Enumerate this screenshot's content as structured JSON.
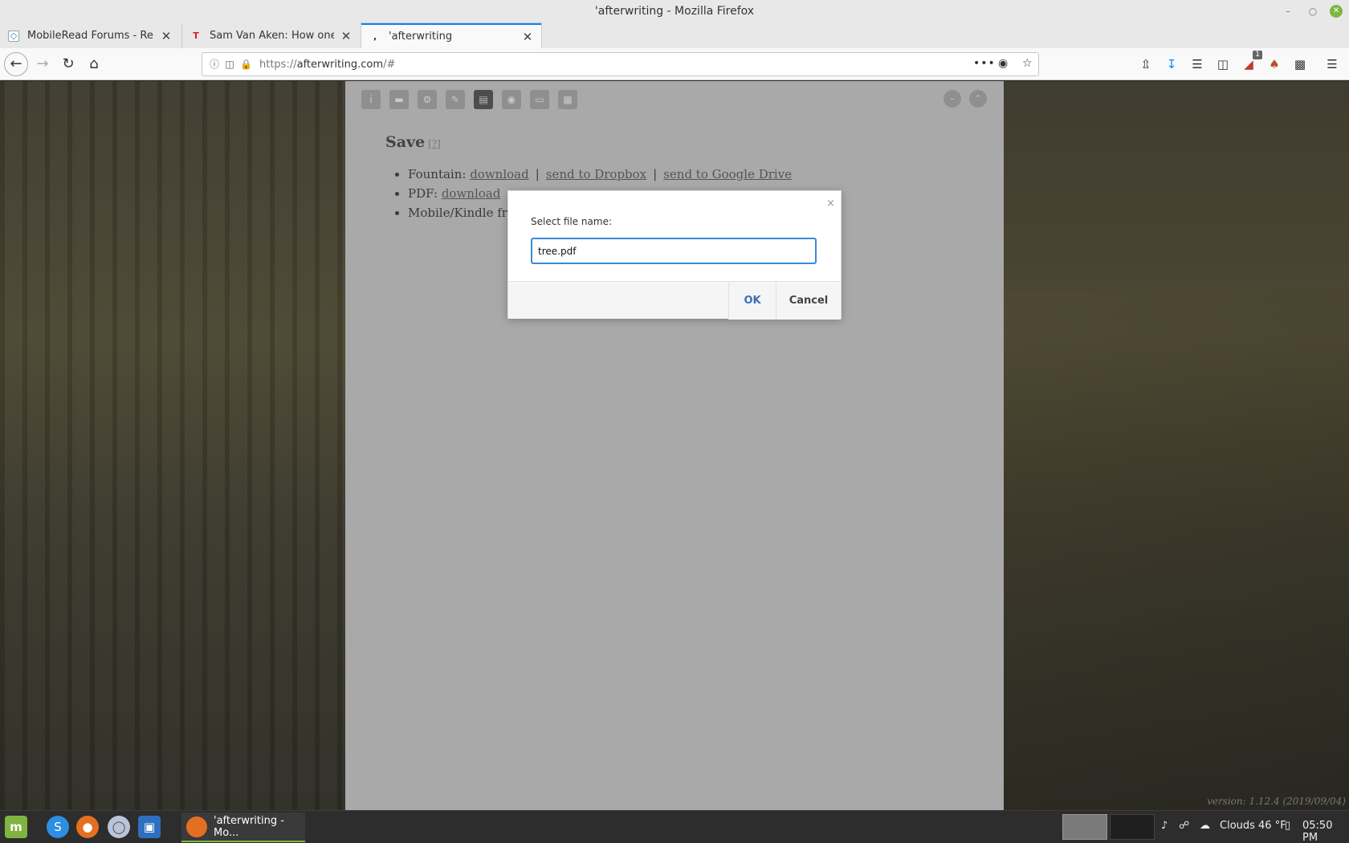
{
  "window": {
    "title": "'afterwriting - Mozilla Firefox"
  },
  "tabs": [
    {
      "label": "MobileRead Forums - Reply to",
      "icon": "mobileread-favicon"
    },
    {
      "label": "Sam Van Aken: How one tree",
      "icon": "t-favicon",
      "icon_glyph": "T"
    },
    {
      "label": "'afterwriting",
      "icon": "afterwriting-favicon",
      "icon_glyph": "‚"
    }
  ],
  "urlbar": {
    "prefix": "https://",
    "domain": "afterwriting.com",
    "path": "/#"
  },
  "toolbar": {
    "notification_badge": "1"
  },
  "panel": {
    "title": "Save",
    "help": "[?]",
    "items": [
      {
        "label": "Fountain:",
        "links": [
          "download",
          "send to Dropbox",
          "send to Google Drive"
        ]
      },
      {
        "label": "PDF:",
        "links": [
          "download"
        ]
      },
      {
        "label": "Mobile/Kindle fr"
      }
    ],
    "separator": "|",
    "version": "version: 1.12.4 (2019/09/04)"
  },
  "dialog": {
    "label": "Select file name:",
    "value": "tree.pdf",
    "ok": "OK",
    "cancel": "Cancel",
    "close": "×"
  },
  "taskbar": {
    "window_label": "'afterwriting - Mo...",
    "weather": "Clouds 46 °F",
    "clock": "05:50 PM"
  },
  "colors": {
    "accent": "#0a84ff",
    "panel_bg": "#a9a9a9",
    "dialog_focus": "#3b89d9",
    "mint_green": "#7fb53f"
  }
}
